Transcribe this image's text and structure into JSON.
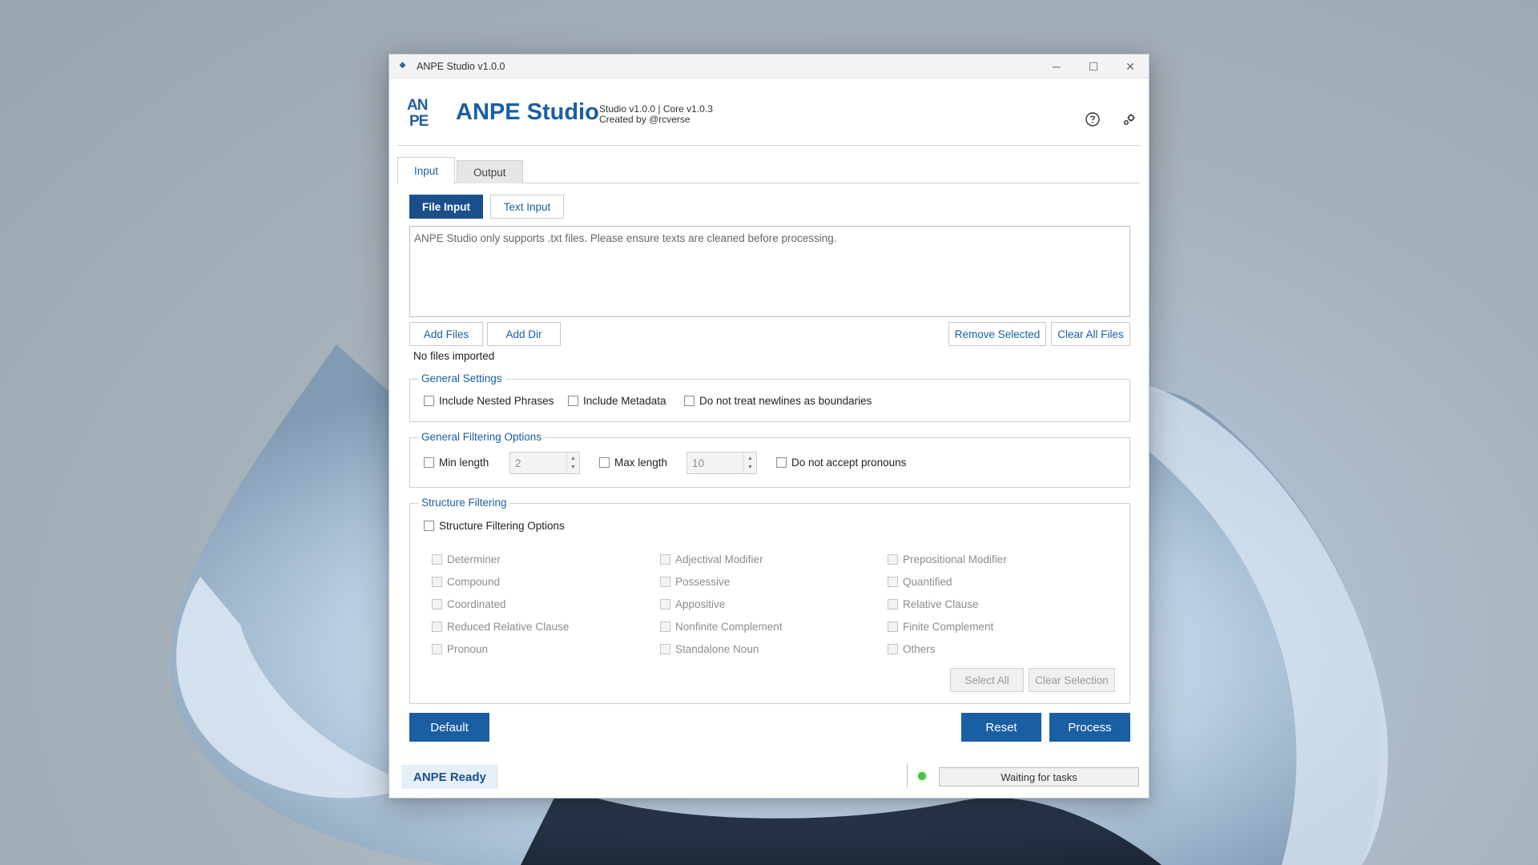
{
  "window": {
    "title": "ANPE Studio v1.0.0"
  },
  "header": {
    "logo_text": "AN PE",
    "brand": "ANPE Studio",
    "version_line": "Studio v1.0.0 | Core v1.0.3",
    "credit_line": "Created by @rcverse"
  },
  "tabs": [
    {
      "label": "Input",
      "active": true
    },
    {
      "label": "Output",
      "active": false
    }
  ],
  "mode_buttons": {
    "file_input": "File Input",
    "text_input": "Text Input"
  },
  "input_area": {
    "hint": "ANPE Studio only supports .txt files. Please ensure texts are cleaned before processing."
  },
  "file_buttons": {
    "add_files": "Add Files",
    "add_dir": "Add Dir",
    "remove_selected": "Remove Selected",
    "clear_all": "Clear All Files"
  },
  "files_status": "No files imported",
  "general_settings": {
    "title": "General Settings",
    "options": [
      "Include Nested Phrases",
      "Include Metadata",
      "Do not treat newlines as boundaries"
    ]
  },
  "filtering": {
    "title": "General Filtering Options",
    "min_label": "Min length",
    "min_value": "2",
    "max_label": "Max length",
    "max_value": "10",
    "pronouns_label": "Do not accept pronouns"
  },
  "structure": {
    "title": "Structure Filtering",
    "master_label": "Structure Filtering Options",
    "col1": [
      "Determiner",
      "Compound",
      "Coordinated",
      "Reduced Relative Clause",
      "Pronoun"
    ],
    "col2": [
      "Adjectival Modifier",
      "Possessive",
      "Appositive",
      "Nonfinite Complement",
      "Standalone Noun"
    ],
    "col3": [
      "Prepositional Modifier",
      "Quantified",
      "Relative Clause",
      "Finite Complement",
      "Others"
    ],
    "select_all": "Select All",
    "clear_selection": "Clear Selection"
  },
  "actions": {
    "default": "Default",
    "reset": "Reset",
    "process": "Process"
  },
  "status": {
    "ready": "ANPE Ready",
    "task": "Waiting for tasks",
    "led_color": "#4bbd4b"
  },
  "colors": {
    "accent": "#1a5fa3",
    "primary_dark": "#1a4f8c"
  },
  "icons": {
    "help": "help-icon",
    "settings": "settings-icon",
    "app": "app-icon"
  }
}
